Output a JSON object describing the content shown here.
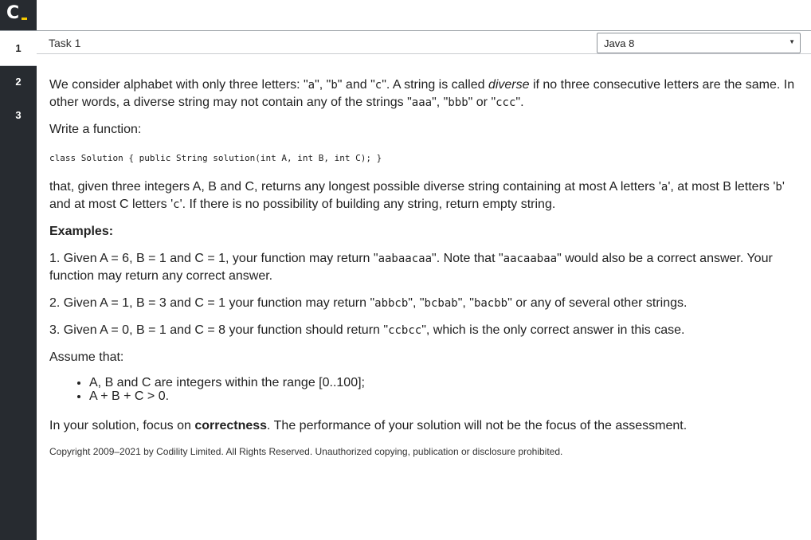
{
  "sidebar": {
    "logo": "C",
    "tabs": [
      {
        "label": "1"
      },
      {
        "label": "2"
      },
      {
        "label": "3"
      }
    ]
  },
  "taskbar": {
    "title": "Task 1",
    "language": "Java 8"
  },
  "content": {
    "intro": {
      "t1": "We consider alphabet with only three letters: \"",
      "c1": "a",
      "t2": "\", \"",
      "c2": "b",
      "t3": "\" and \"",
      "c3": "c",
      "t4": "\". A string is called ",
      "em": "diverse",
      "t5": " if no three consecutive letters are the same. In other words, a diverse string may not contain any of the strings \"",
      "c4": "aaa",
      "t6": "\", \"",
      "c5": "bbb",
      "t7": "\" or \"",
      "c6": "ccc",
      "t8": "\"."
    },
    "write_function": "Write a function:",
    "code": "class Solution { public String solution(int A, int B, int C); }",
    "description": {
      "t1": "that, given three integers A, B and C, returns any longest possible diverse string containing at most A letters '",
      "c1": "a",
      "t2": "', at most B letters '",
      "c2": "b",
      "t3": "' and at most C letters '",
      "c3": "c",
      "t4": "'. If there is no possibility of building any string, return empty string."
    },
    "examples_heading": "Examples:",
    "example1": {
      "t1": "1. Given A = 6, B = 1 and C = 1, your function may return \"",
      "c1": "aabaacaa",
      "t2": "\". Note that \"",
      "c2": "aacaabaa",
      "t3": "\" would also be a correct answer. Your function may return any correct answer."
    },
    "example2": {
      "t1": "2. Given A = 1, B = 3 and C = 1 your function may return \"",
      "c1": "abbcb",
      "t2": "\", \"",
      "c2": "bcbab",
      "t3": "\", \"",
      "c3": "bacbb",
      "t4": "\" or any of several other strings."
    },
    "example3": {
      "t1": "3. Given A = 0, B = 1 and C = 8 your function should return \"",
      "c1": "ccbcc",
      "t2": "\", which is the only correct answer in this case."
    },
    "assume_heading": "Assume that:",
    "assumptions": [
      "A, B and C are integers within the range [0..100];",
      "A + B + C > 0."
    ],
    "focus": {
      "t1": "In your solution, focus on ",
      "bold": "correctness",
      "t2": ". The performance of your solution will not be the focus of the assessment."
    },
    "copyright": "Copyright 2009–2021 by Codility Limited. All Rights Reserved. Unauthorized copying, publication or disclosure prohibited."
  },
  "colors": {
    "sidebar": "#272b30",
    "logo_accent": "#f6c900"
  }
}
